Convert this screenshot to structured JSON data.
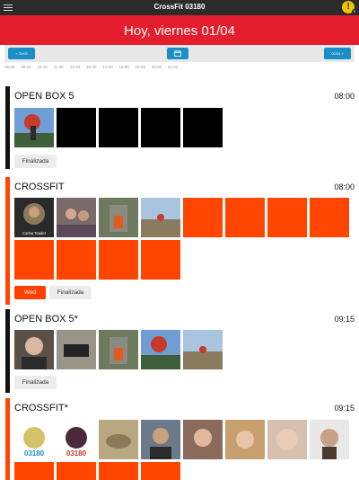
{
  "app": {
    "title": "CrossFit 03180",
    "alert_symbol": "!",
    "alert_count": "0"
  },
  "header": {
    "day": "Hoy, viernes 01/04"
  },
  "datebar": {
    "prev_label": "« 31/03",
    "next_label": "02/04 »"
  },
  "hours": [
    "08:00",
    "09:15",
    "10:15",
    "11:00",
    "14:30",
    "16:00",
    "17:00",
    "18:00",
    "19:00",
    "20:00",
    "21:00"
  ],
  "classes": [
    {
      "name": "OPEN BOX 5",
      "time": "08:00",
      "color": "#111111",
      "tags": [
        "Finalizada"
      ]
    },
    {
      "name": "CROSSFIT",
      "time": "08:00",
      "color": "#ff4500",
      "photo_caption": "Corina Toader",
      "tags": [
        "Wod",
        "Finalizada"
      ]
    },
    {
      "name": "OPEN BOX 5*",
      "time": "09:15",
      "color": "#111111",
      "tags": [
        "Finalizada"
      ]
    },
    {
      "name": "CROSSFIT*",
      "time": "09:15",
      "color": "#ff4500",
      "logo_text": "03180"
    }
  ],
  "colors": {
    "accent_red": "#e41e2d",
    "nav_blue": "#1a8fc7",
    "orange": "#ff4500"
  }
}
